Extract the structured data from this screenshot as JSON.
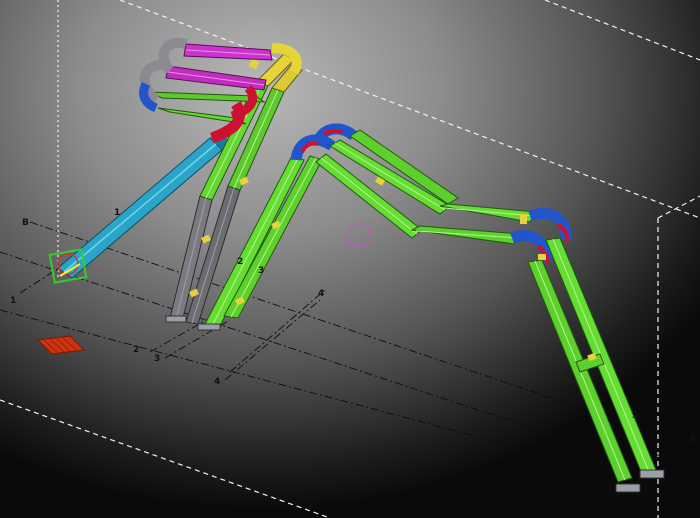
{
  "viewport": {
    "background": "gradient-gray",
    "colors": {
      "green": "#66dd33",
      "yellow": "#e8d840",
      "magenta": "#cc33cc",
      "blue": "#2255cc",
      "red": "#cc1133",
      "cyan": "#2299bb",
      "gray": "#777777",
      "grid": "#e8e8e8",
      "bound": "#f0f0f0"
    }
  },
  "grid_labels": {
    "b": "B",
    "one_left": "1",
    "two": "2",
    "three_a": "3",
    "three_b": "3",
    "four_a": "4",
    "four_b": "4",
    "six": "6"
  },
  "member_labels": {
    "m1": "1",
    "m2": "2",
    "m3": "3",
    "m5": "5"
  },
  "icons": {
    "orbit_center": "orbit-center-icon",
    "ucs_marker": "ucs-marker-icon",
    "plate": "plate-icon"
  }
}
